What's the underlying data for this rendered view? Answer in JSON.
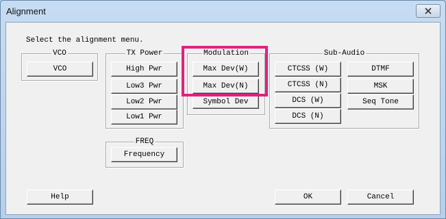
{
  "window": {
    "title": "Alignment"
  },
  "prompt": "Select the alignment menu.",
  "groups": {
    "vco": {
      "label": "VCO",
      "buttons": [
        "VCO"
      ]
    },
    "tx_power": {
      "label": "TX Power",
      "buttons": [
        "High Pwr",
        "Low3 Pwr",
        "Low2 Pwr",
        "Low1 Pwr"
      ]
    },
    "modulation": {
      "label": "Modulation",
      "buttons": [
        "Max Dev(W)",
        "Max Dev(N)",
        "Symbol Dev"
      ]
    },
    "sub_audio": {
      "label": "Sub-Audio",
      "buttons": [
        "CTCSS (W)",
        "CTCSS (N)",
        "DCS (W)",
        "DCS (N)",
        "DTMF",
        "MSK",
        "Seq Tone"
      ]
    },
    "freq": {
      "label": "FREQ",
      "buttons": [
        "Frequency"
      ]
    }
  },
  "footer": {
    "help": "Help",
    "ok": "OK",
    "cancel": "Cancel"
  },
  "icons": {
    "close": "close-icon"
  },
  "colors": {
    "highlight": "#e0227e",
    "titlebar": "#b6d0ea",
    "client": "#f0f0f0"
  }
}
